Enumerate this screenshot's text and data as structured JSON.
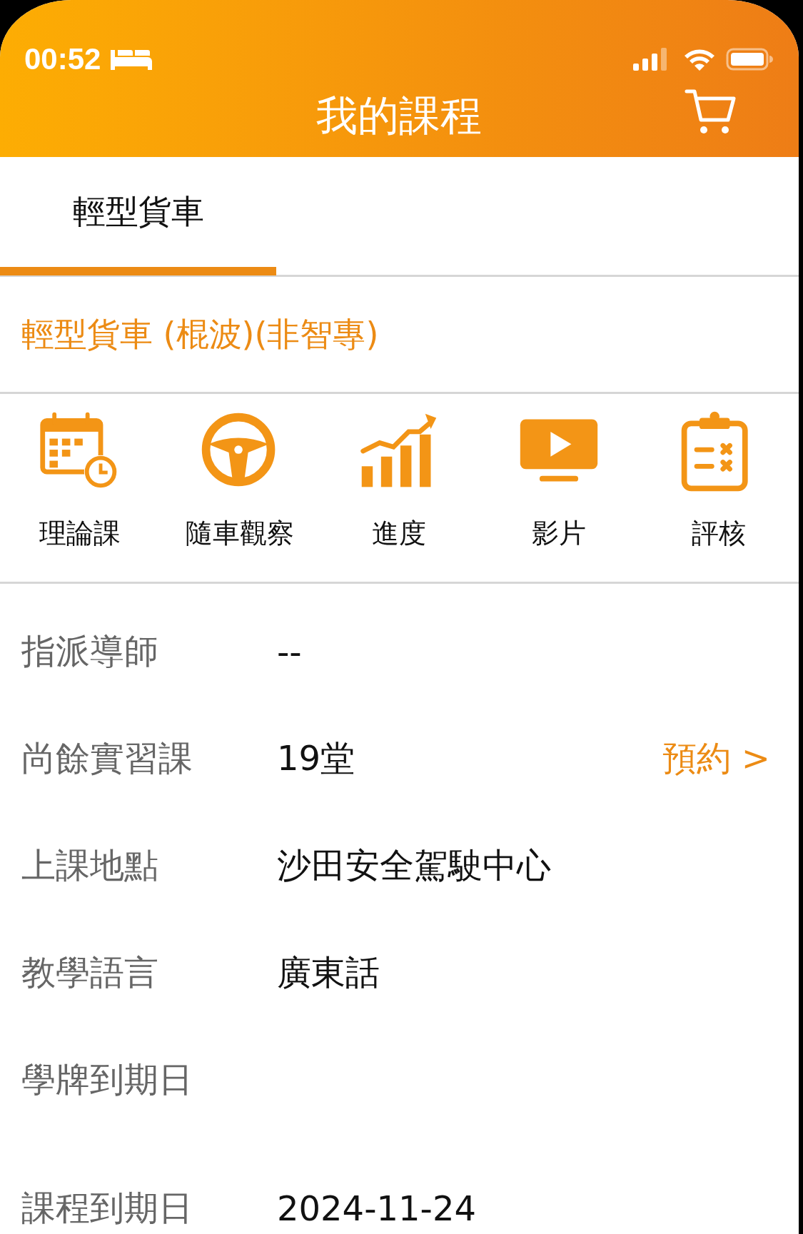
{
  "status_bar": {
    "time": "00:52"
  },
  "header": {
    "title": "我的課程"
  },
  "tabs": [
    {
      "label": "輕型貨車",
      "selected": true
    }
  ],
  "course_title": "輕型貨車 (棍波)(非智專)",
  "features": [
    {
      "label": "理論課",
      "kind": "calendar"
    },
    {
      "label": "隨車觀察",
      "kind": "wheel"
    },
    {
      "label": "進度",
      "kind": "chart"
    },
    {
      "label": "影片",
      "kind": "video"
    },
    {
      "label": "評核",
      "kind": "clipboard"
    }
  ],
  "details": [
    {
      "label": "指派導師",
      "value": "--"
    },
    {
      "label": "尚餘實習課",
      "value": "19堂",
      "action": "預約 >"
    },
    {
      "label": "上課地點",
      "value": "沙田安全駕駛中心"
    },
    {
      "label": "教學語言",
      "value": "廣東話"
    },
    {
      "label": "學牌到期日"
    },
    {
      "label": "課程到期日",
      "value": "2024-11-24"
    }
  ]
}
